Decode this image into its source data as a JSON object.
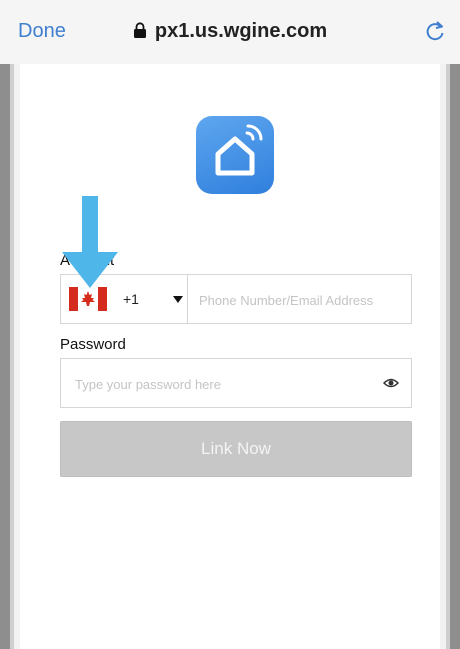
{
  "browser": {
    "done_label": "Done",
    "url": "px1.us.wgine.com",
    "lock_icon": "lock-icon",
    "reload_icon": "reload-icon"
  },
  "app": {
    "icon": "smart-home-icon",
    "brand_color": "#3b8ae6"
  },
  "form": {
    "account_label": "Account",
    "country_flag": "canada-flag-icon",
    "country_code": "+1",
    "phone_placeholder": "Phone Number/Email Address",
    "password_label": "Password",
    "password_placeholder": "Type your password here",
    "eye_icon": "eye-icon",
    "submit_label": "Link Now"
  },
  "annotation": {
    "arrow_color": "#4fb6ea",
    "icon": "arrow-down-icon"
  }
}
